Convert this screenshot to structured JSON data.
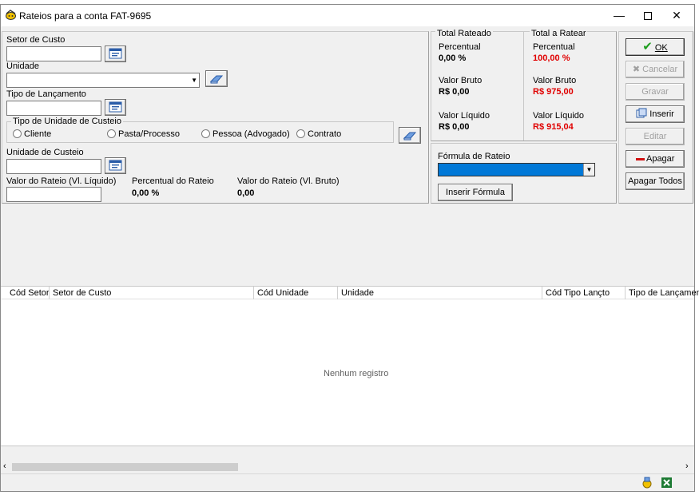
{
  "window": {
    "title": "Rateios para a conta FAT-9695"
  },
  "form": {
    "setor_label": "Setor de Custo",
    "setor_value": "",
    "unidade_label": "Unidade",
    "unidade_value": "",
    "tipo_lanc_label": "Tipo de Lançamento",
    "tipo_lanc_value": "",
    "tipo_unidade_label": "Tipo de Unidade de Custeio",
    "radios": [
      "Cliente",
      "Pasta/Processo",
      "Pessoa (Advogado)",
      "Contrato"
    ],
    "unidade_custeio_label": "Unidade de Custeio",
    "unidade_custeio_value": "",
    "valor_liquido_label": "Valor do Rateio (Vl. Líquido)",
    "valor_liquido_value": "",
    "percentual_label": "Percentual do Rateio",
    "percentual_value": "0,00 %",
    "valor_bruto_label": "Valor do Rateio (Vl. Bruto)",
    "valor_bruto_value": "0,00"
  },
  "totals": {
    "rateado": {
      "title": "Total Rateado",
      "percentual_label": "Percentual",
      "percentual_value": "0,00 %",
      "bruto_label": "Valor Bruto",
      "bruto_value": "R$ 0,00",
      "liquido_label": "Valor Líquido",
      "liquido_value": "R$ 0,00"
    },
    "ratear": {
      "title": "Total a Ratear",
      "percentual_label": "Percentual",
      "percentual_value": "100,00 %",
      "bruto_label": "Valor Bruto",
      "bruto_value": "R$ 975,00",
      "liquido_label": "Valor Líquido",
      "liquido_value": "R$ 915,04"
    }
  },
  "formula": {
    "label": "Fórmula de Rateio",
    "insert_button": "Inserir Fórmula"
  },
  "actions": {
    "ok": "OK",
    "cancelar": "Cancelar",
    "gravar": "Gravar",
    "inserir": "Inserir",
    "editar": "Editar",
    "apagar": "Apagar",
    "apagar_todos": "Apagar Todos"
  },
  "grid": {
    "columns": [
      "Cód Setor",
      "Setor de Custo",
      "Cód Unidade",
      "Unidade",
      "Cód Tipo Lançto",
      "Tipo de Lançamento"
    ],
    "empty_text": "Nenhum registro"
  },
  "colors": {
    "accent_red": "#e00000",
    "selection_blue": "#0078d7",
    "ok_green": "#1e9e1e"
  }
}
